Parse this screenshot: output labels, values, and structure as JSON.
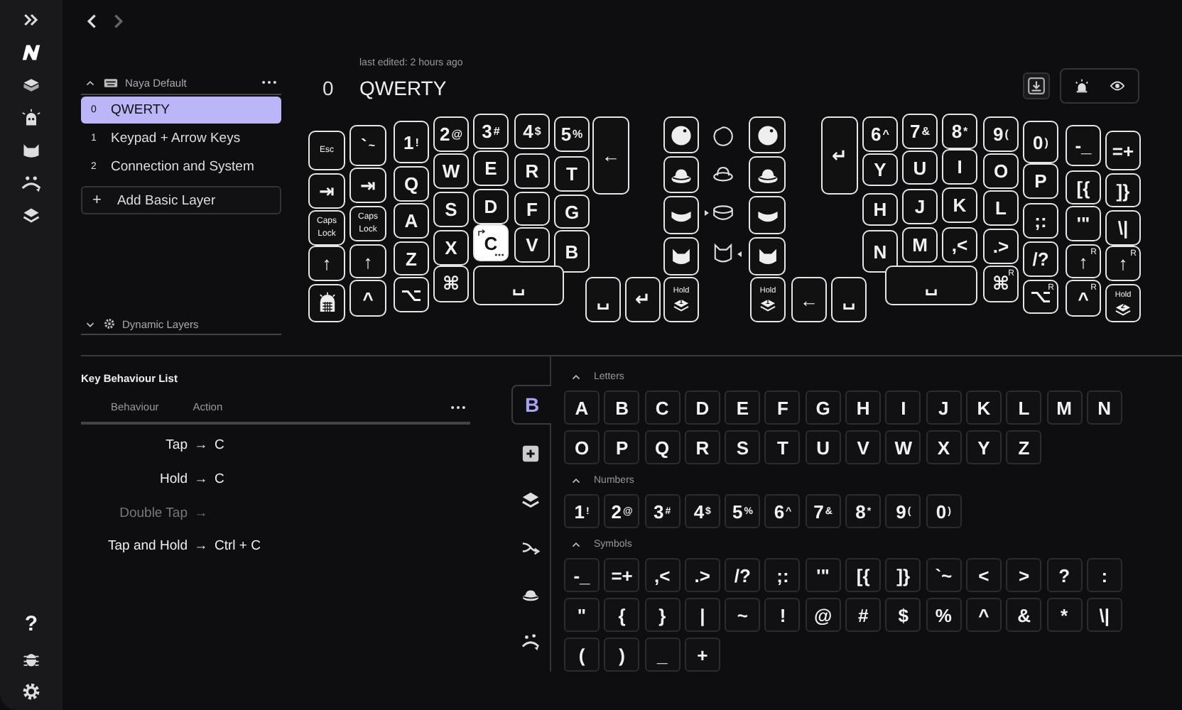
{
  "rail": {
    "help": "?"
  },
  "layers_panel": {
    "title": "Naya Default",
    "layers": [
      {
        "index": "0",
        "label": "QWERTY",
        "selected": true
      },
      {
        "index": "1",
        "label": "Keypad + Arrow Keys",
        "selected": false
      },
      {
        "index": "2",
        "label": "Connection and System",
        "selected": false
      }
    ],
    "add_button": {
      "icon": "+",
      "label": "Add Basic Layer"
    },
    "dynamic_title": "Dynamic Layers"
  },
  "layer_header": {
    "edited": "last edited: 2 hours ago",
    "index": "0",
    "title": "QWERTY"
  },
  "keyboard": {
    "keys": [
      {
        "kind": "text",
        "label": "Esc",
        "small": true,
        "selected": false
      },
      {
        "kind": "text",
        "label": "`",
        "shift": "~",
        "selected": false
      },
      {
        "kind": "text",
        "label": "1",
        "shift": "!",
        "selected": false
      },
      {
        "kind": "text",
        "label": "2",
        "shift": "@",
        "selected": false
      },
      {
        "kind": "text",
        "label": "3",
        "shift": "#",
        "selected": false
      },
      {
        "kind": "text",
        "label": "4",
        "shift": "$",
        "selected": false
      },
      {
        "kind": "text",
        "label": "5",
        "shift": "%",
        "selected": false
      },
      {
        "kind": "text",
        "label": "←",
        "selected": false
      },
      {
        "kind": "text",
        "label": "⇥",
        "selected": false
      },
      {
        "kind": "text",
        "label": "⇥",
        "selected": false
      },
      {
        "kind": "text",
        "label": "Q",
        "selected": false
      },
      {
        "kind": "text",
        "label": "W",
        "selected": false
      },
      {
        "kind": "text",
        "label": "E",
        "selected": false
      },
      {
        "kind": "text",
        "label": "R",
        "selected": false
      },
      {
        "kind": "text",
        "label": "T",
        "selected": false
      },
      {
        "kind": "text",
        "label": "Caps Lock",
        "small": true,
        "selected": false
      },
      {
        "kind": "text",
        "label": "Caps Lock",
        "small": true,
        "selected": false
      },
      {
        "kind": "text",
        "label": "A",
        "selected": false
      },
      {
        "kind": "text",
        "label": "S",
        "selected": false
      },
      {
        "kind": "text",
        "label": "D",
        "selected": false
      },
      {
        "kind": "text",
        "label": "F",
        "selected": false
      },
      {
        "kind": "text",
        "label": "G",
        "selected": false
      },
      {
        "kind": "text",
        "label": "↑",
        "selected": false
      },
      {
        "kind": "text",
        "label": "↑",
        "selected": false
      },
      {
        "kind": "text",
        "label": "Z",
        "selected": false
      },
      {
        "kind": "text",
        "label": "X",
        "selected": false
      },
      {
        "kind": "text",
        "label": "C",
        "selected": true,
        "multi": true
      },
      {
        "kind": "text",
        "label": "V",
        "selected": false
      },
      {
        "kind": "text",
        "label": "B",
        "selected": false
      },
      {
        "kind": "icon",
        "selected": false
      },
      {
        "kind": "text",
        "label": "^",
        "selected": false
      },
      {
        "kind": "text",
        "label": "⌥",
        "selected": false
      },
      {
        "kind": "text",
        "label": "⌘",
        "selected": false
      },
      {
        "kind": "text",
        "label": "␣",
        "selected": false
      },
      {
        "kind": "text",
        "label": "␣",
        "selected": false
      },
      {
        "kind": "text",
        "label": "↵",
        "selected": false
      },
      {
        "kind": "icon",
        "selected": false
      },
      {
        "kind": "icon",
        "selected": false
      },
      {
        "kind": "icon",
        "selected": false
      },
      {
        "kind": "icon",
        "selected": false
      },
      {
        "kind": "icon",
        "selected": false
      },
      {
        "kind": "icon",
        "selected": false
      },
      {
        "kind": "icon",
        "selected": false
      },
      {
        "kind": "icon",
        "selected": false
      },
      {
        "kind": "hold",
        "label": "Hold",
        "layer": "1",
        "selected": false
      },
      {
        "kind": "hold",
        "label": "Hold",
        "layer": "1",
        "selected": false
      },
      {
        "kind": "text",
        "label": "←",
        "selected": false
      },
      {
        "kind": "text",
        "label": "␣",
        "selected": false
      },
      {
        "kind": "text",
        "label": "↵",
        "selected": false
      },
      {
        "kind": "text",
        "label": "6",
        "shift": "^",
        "selected": false
      },
      {
        "kind": "text",
        "label": "7",
        "shift": "&",
        "selected": false
      },
      {
        "kind": "text",
        "label": "8",
        "shift": "*",
        "selected": false
      },
      {
        "kind": "text",
        "label": "9",
        "shift": "(",
        "selected": false
      },
      {
        "kind": "text",
        "label": "0",
        "shift": ")",
        "selected": false
      },
      {
        "kind": "text",
        "label": "-_",
        "selected": false
      },
      {
        "kind": "text",
        "label": "=+",
        "selected": false
      },
      {
        "kind": "text",
        "label": "Y",
        "selected": false
      },
      {
        "kind": "text",
        "label": "U",
        "selected": false
      },
      {
        "kind": "text",
        "label": "I",
        "selected": false
      },
      {
        "kind": "text",
        "label": "O",
        "selected": false
      },
      {
        "kind": "text",
        "label": "P",
        "selected": false
      },
      {
        "kind": "text",
        "label": "[{",
        "selected": false
      },
      {
        "kind": "text",
        "label": "]}",
        "selected": false
      },
      {
        "kind": "text",
        "label": "H",
        "selected": false
      },
      {
        "kind": "text",
        "label": "J",
        "selected": false
      },
      {
        "kind": "text",
        "label": "K",
        "selected": false
      },
      {
        "kind": "text",
        "label": "L",
        "selected": false
      },
      {
        "kind": "text",
        "label": ";:",
        "selected": false
      },
      {
        "kind": "text",
        "label": "'\"",
        "selected": false
      },
      {
        "kind": "text",
        "label": "\\|",
        "selected": false
      },
      {
        "kind": "text",
        "label": "N",
        "selected": false
      },
      {
        "kind": "text",
        "label": "M",
        "selected": false
      },
      {
        "kind": "text",
        "label": ",<",
        "selected": false
      },
      {
        "kind": "text",
        "label": ".>",
        "selected": false
      },
      {
        "kind": "text",
        "label": "/?",
        "selected": false
      },
      {
        "kind": "text",
        "label": "↑",
        "side": "R",
        "selected": false
      },
      {
        "kind": "text",
        "label": "↑",
        "side": "R",
        "selected": false
      },
      {
        "kind": "text",
        "label": "␣",
        "selected": false
      },
      {
        "kind": "text",
        "label": "⌘",
        "side": "R",
        "selected": false
      },
      {
        "kind": "text",
        "label": "⌥",
        "side": "R",
        "selected": false
      },
      {
        "kind": "text",
        "label": "^",
        "side": "R",
        "selected": false
      },
      {
        "kind": "hold",
        "label": "Hold",
        "layer": "2",
        "selected": false
      }
    ]
  },
  "behaviour_list": {
    "title": "Key Behaviour List",
    "columns": [
      "Behaviour",
      "Action"
    ],
    "rows": [
      {
        "behaviour": "Tap",
        "arrow": "→",
        "action": "C",
        "disabled": false
      },
      {
        "behaviour": "Hold",
        "arrow": "→",
        "action": "C",
        "disabled": false
      },
      {
        "behaviour": "Double Tap",
        "arrow": "→",
        "disabled": true
      },
      {
        "behaviour": "Tap and Hold",
        "arrow": "→",
        "action": "Ctrl + C",
        "disabled": false
      }
    ]
  },
  "picker": {
    "tabs": [
      {
        "kind": "text",
        "label": "B",
        "selected": true
      },
      {
        "kind": "icon",
        "selected": false
      },
      {
        "kind": "icon",
        "selected": false
      },
      {
        "kind": "icon",
        "selected": false
      },
      {
        "kind": "icon",
        "selected": false
      },
      {
        "kind": "icon",
        "selected": false
      }
    ],
    "sections": [
      {
        "title": "Letters",
        "expanded": true,
        "keys": [
          {
            "label": "A"
          },
          {
            "label": "B"
          },
          {
            "label": "C"
          },
          {
            "label": "D"
          },
          {
            "label": "E"
          },
          {
            "label": "F"
          },
          {
            "label": "G"
          },
          {
            "label": "H"
          },
          {
            "label": "I"
          },
          {
            "label": "J"
          },
          {
            "label": "K"
          },
          {
            "label": "L"
          },
          {
            "label": "M"
          },
          {
            "label": "N"
          },
          {
            "label": "O"
          },
          {
            "label": "P"
          },
          {
            "label": "Q"
          },
          {
            "label": "R"
          },
          {
            "label": "S"
          },
          {
            "label": "T"
          },
          {
            "label": "U"
          },
          {
            "label": "V"
          },
          {
            "label": "W"
          },
          {
            "label": "X"
          },
          {
            "label": "Y"
          },
          {
            "label": "Z"
          }
        ]
      },
      {
        "title": "Numbers",
        "expanded": true,
        "keys": [
          {
            "label": "1",
            "shift": "!"
          },
          {
            "label": "2",
            "shift": "@"
          },
          {
            "label": "3",
            "shift": "#"
          },
          {
            "label": "4",
            "shift": "$"
          },
          {
            "label": "5",
            "shift": "%"
          },
          {
            "label": "6",
            "shift": "^"
          },
          {
            "label": "7",
            "shift": "&"
          },
          {
            "label": "8",
            "shift": "*"
          },
          {
            "label": "9",
            "shift": "("
          },
          {
            "label": "0",
            "shift": ")"
          }
        ]
      },
      {
        "title": "Symbols",
        "expanded": true,
        "keys": [
          {
            "label": "-_"
          },
          {
            "label": "=+"
          },
          {
            "label": ",<"
          },
          {
            "label": ".>"
          },
          {
            "label": "/?"
          },
          {
            "label": ";:"
          },
          {
            "label": "'\""
          },
          {
            "label": "[{"
          },
          {
            "label": "]}"
          },
          {
            "label": "`~"
          },
          {
            "label": "<"
          },
          {
            "label": ">"
          },
          {
            "label": "?"
          },
          {
            "label": ":"
          },
          {
            "label": "\""
          },
          {
            "label": "{"
          },
          {
            "label": "}"
          },
          {
            "label": "|"
          },
          {
            "label": "~"
          },
          {
            "label": "!"
          },
          {
            "label": "@"
          },
          {
            "label": "#"
          },
          {
            "label": "$"
          },
          {
            "label": "%"
          },
          {
            "label": "^"
          },
          {
            "label": "&"
          },
          {
            "label": "*"
          },
          {
            "label": "\\|"
          },
          {
            "label": "("
          },
          {
            "label": ")"
          },
          {
            "label": "_"
          },
          {
            "label": "+"
          }
        ]
      }
    ]
  }
}
